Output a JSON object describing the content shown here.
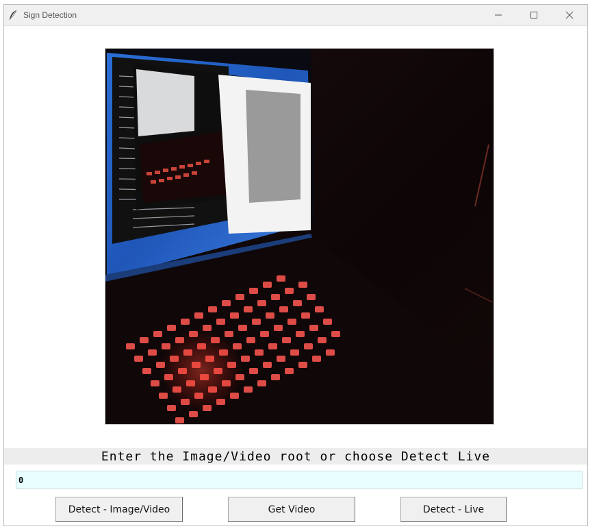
{
  "window": {
    "title": "Sign Detection",
    "icon": "feather-icon",
    "controls": [
      "minimize-icon",
      "maximize-icon",
      "close-icon"
    ]
  },
  "preview": {
    "content": "live camera feed of a laptop with red backlit keyboard"
  },
  "prompt": {
    "text": "Enter the Image/Video root or choose Detect Live"
  },
  "path_input": {
    "value": "0",
    "background": "#e9ffff"
  },
  "buttons": {
    "detect_image_video": "Detect - Image/Video",
    "get_video": "Get Video",
    "detect_live": "Detect - Live"
  }
}
